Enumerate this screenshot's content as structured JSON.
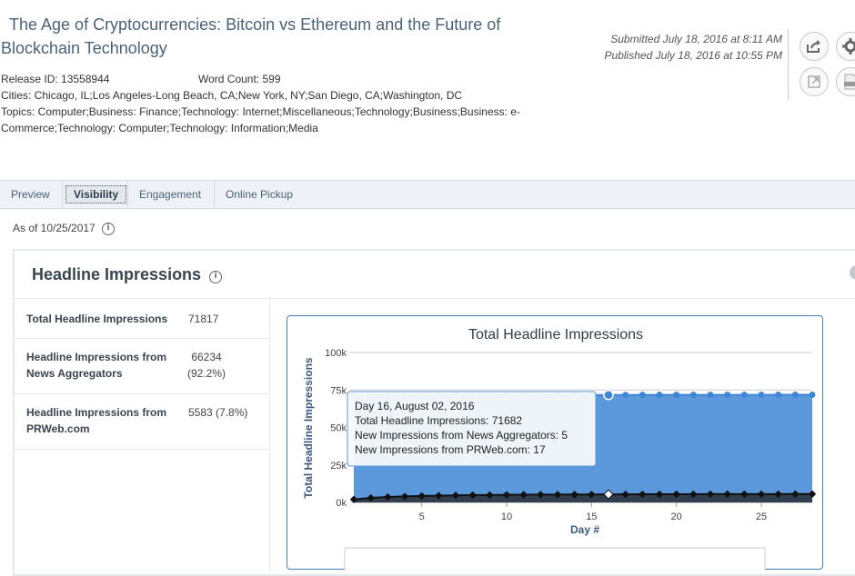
{
  "release": {
    "title": "The Age of Cryptocurrencies: Bitcoin vs Ethereum and the Future of Blockchain Technology",
    "release_id": "Release ID: 13558944",
    "word_count": "Word Count: 599",
    "cities": "Cities: Chicago, IL;Los Angeles-Long Beach, CA;New York, NY;San Diego, CA;Washington, DC",
    "topics": "Topics: Computer;Business: Finance;Technology: Internet;Miscellaneous;Technology;Business;Business: e-Commerce;Technology: Computer;Technology: Information;Media",
    "submitted": "Submitted July 18, 2016 at 8:11 AM",
    "published": "Published July 18, 2016 at 10:55 PM"
  },
  "toolbar_icons": [
    "share-icon",
    "gear-icon",
    "external-link-icon",
    "pdf-icon"
  ],
  "tabs": [
    {
      "label": "Preview"
    },
    {
      "label": "Visibility"
    },
    {
      "label": "Engagement"
    },
    {
      "label": "Online Pickup"
    }
  ],
  "as_of": "As of 10/25/2017",
  "panel": {
    "title": "Headline Impressions",
    "stats": [
      {
        "label": "Total Headline Impressions",
        "value": "71817"
      },
      {
        "label": "Headline Impressions from News Aggregators",
        "value": "66234 (92.2%)"
      },
      {
        "label": "Headline Impressions from PRWeb.com",
        "value": "5583 (7.8%)"
      }
    ]
  },
  "chart_data": {
    "type": "area",
    "title": "Total Headline Impressions",
    "xlabel": "Day #",
    "ylabel": "Total Headline Impressions",
    "xlim": [
      1,
      28
    ],
    "ylim": [
      0,
      100000
    ],
    "xticks": [
      5,
      10,
      15,
      20,
      25
    ],
    "yticks": [
      {
        "value": 0,
        "label": "0k"
      },
      {
        "value": 25000,
        "label": "25k"
      },
      {
        "value": 50000,
        "label": "50k"
      },
      {
        "value": 75000,
        "label": "75k"
      },
      {
        "value": 100000,
        "label": "100k"
      }
    ],
    "grid": true,
    "x": [
      1,
      2,
      3,
      4,
      5,
      6,
      7,
      8,
      9,
      10,
      11,
      12,
      13,
      14,
      15,
      16,
      17,
      18,
      19,
      20,
      21,
      22,
      23,
      24,
      25,
      26,
      27,
      28
    ],
    "series": [
      {
        "color": "#5b98dc",
        "values": [
          71300,
          71400,
          71450,
          71500,
          71520,
          71540,
          71560,
          71580,
          71600,
          71610,
          71620,
          71630,
          71640,
          71650,
          71660,
          71682,
          71700,
          71710,
          71720,
          71730,
          71740,
          71750,
          71760,
          71770,
          71780,
          71790,
          71800,
          71817
        ]
      },
      {
        "color": "#2b3440",
        "values": [
          2000,
          3000,
          3600,
          4000,
          4300,
          4500,
          4700,
          4850,
          4950,
          5050,
          5150,
          5200,
          5250,
          5300,
          5330,
          5360,
          5400,
          5420,
          5440,
          5460,
          5480,
          5500,
          5520,
          5540,
          5550,
          5560,
          5570,
          5583
        ]
      }
    ],
    "tooltip": {
      "day": 16,
      "lines": [
        "Day 16, August 02, 2016",
        "Total Headline Impressions: 71682",
        "New Impressions from News Aggregators: 5",
        "New Impressions from PRWeb.com: 17"
      ]
    }
  }
}
